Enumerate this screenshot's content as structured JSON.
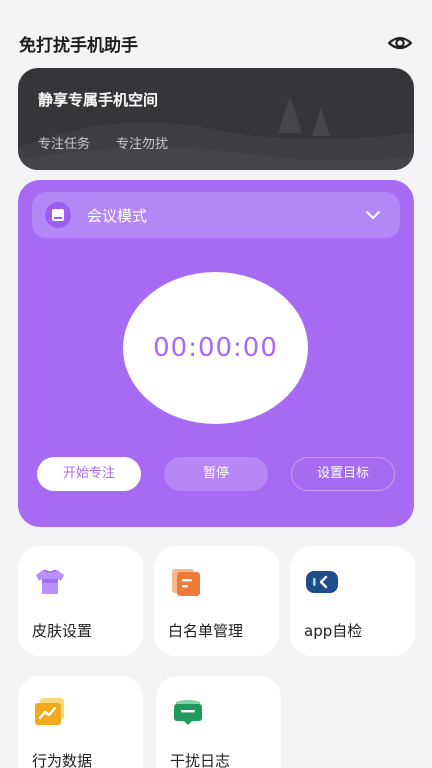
{
  "header": {
    "title": "免打扰手机助手",
    "visibility_icon": "eye-icon"
  },
  "banner": {
    "title": "静享专属手机空间",
    "tags": [
      "专注任务",
      "专注勿扰"
    ]
  },
  "focus": {
    "mode_icon": "tablet-icon",
    "mode_label": "会议模式",
    "timer": "00:00:00",
    "start_label": "开始专注",
    "pause_label": "暂停",
    "goal_label": "设置目标"
  },
  "tools": [
    {
      "label": "皮肤设置",
      "icon": "tshirt-icon",
      "color": "#a66bf2"
    },
    {
      "label": "白名单管理",
      "icon": "list-doc-icon",
      "color": "#f07a3a"
    },
    {
      "label": "app自检",
      "icon": "app-check-icon",
      "color": "#1d4e8a"
    },
    {
      "label": "行为数据",
      "icon": "chart-icon",
      "color": "#f2a91b"
    },
    {
      "label": "干扰日志",
      "icon": "chat-book-icon",
      "color": "#1f9a5a"
    }
  ],
  "colors": {
    "accent": "#a66bf2",
    "banner": "#35353a",
    "background": "#f4f4f6"
  }
}
